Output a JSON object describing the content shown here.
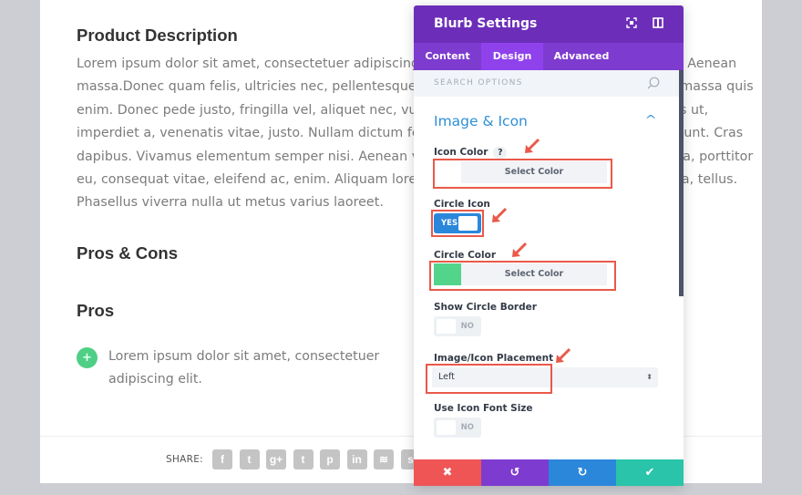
{
  "page": {
    "heading_description": "Product Description",
    "body_lines": [
      "Lorem ipsum dolor sit amet, consectetuer adipiscing elit. Aenean commodo ligula eget dolor. Aenean",
      "massa.Donec quam felis, ultricies nec, pellentesque eu, pretium quis, sem. Nulla consequat massa quis",
      "enim. Donec pede justo, fringilla vel, aliquet nec, vulputate eget, arcu. In enim justo, rhoncus ut,",
      "imperdiet a, venenatis vitae, justo. Nullam dictum felis eu pede mollis pretium. Integer tincidunt. Cras",
      "dapibus. Vivamus elementum semper nisi. Aenean vulputate eleifend tellus. Aenean leo ligula, porttitor",
      "eu, consequat vitae, eleifend ac, enim. Aliquam lorem ante, dapibus in, viverra quis, feugiat a, tellus.",
      "Phasellus viverra nulla ut metus varius laoreet."
    ],
    "heading_pros_cons": "Pros & Cons",
    "heading_pros": "Pros",
    "pro_items": [
      {
        "icon": "plus-circle-icon",
        "glyph": "+",
        "text": "Lorem ipsum dolor sit amet, consectetuer adipiscing elit."
      }
    ],
    "share": {
      "label": "SHARE:",
      "icons": [
        {
          "name": "facebook-icon",
          "glyph": "f"
        },
        {
          "name": "twitter-icon",
          "glyph": "t"
        },
        {
          "name": "google-plus-icon",
          "glyph": "g+"
        },
        {
          "name": "tumblr-icon",
          "glyph": "t"
        },
        {
          "name": "pinterest-icon",
          "glyph": "p"
        },
        {
          "name": "linkedin-icon",
          "glyph": "in"
        },
        {
          "name": "buffer-icon",
          "glyph": "≋"
        },
        {
          "name": "stumbleupon-icon",
          "glyph": "s"
        }
      ]
    }
  },
  "panel": {
    "title": "Blurb Settings",
    "header_icons": [
      "fullscreen-icon",
      "sidebar-toggle-icon"
    ],
    "tabs": [
      {
        "label": "Content",
        "active": false
      },
      {
        "label": "Design",
        "active": true
      },
      {
        "label": "Advanced",
        "active": false
      }
    ],
    "search_placeholder": "SEARCH OPTIONS",
    "section_title": "Image & Icon",
    "fields": {
      "icon_color": {
        "label": "Icon Color",
        "help": "?",
        "button": "Select Color",
        "value": ""
      },
      "circle_icon": {
        "label": "Circle Icon",
        "value": "YES"
      },
      "circle_color": {
        "label": "Circle Color",
        "button": "Select Color",
        "value": "#52d48b"
      },
      "show_circle_border": {
        "label": "Show Circle Border",
        "value": "NO"
      },
      "placement": {
        "label": "Image/Icon Placement",
        "value": "Left"
      },
      "use_icon_font_size": {
        "label": "Use Icon Font Size",
        "value": "NO"
      }
    },
    "footer": [
      {
        "name": "discard-button",
        "glyph": "✖",
        "color": "#ef5555"
      },
      {
        "name": "undo-button",
        "glyph": "↺",
        "color": "#7e3bd0"
      },
      {
        "name": "redo-button",
        "glyph": "↻",
        "color": "#2b87da"
      },
      {
        "name": "save-button",
        "glyph": "✔",
        "color": "#29c4a9"
      }
    ]
  },
  "colors": {
    "accent_purple": "#6c2eb9",
    "tab_purple": "#7e3bd0",
    "active_tab": "#8f42ec",
    "highlight_red": "#e9594a",
    "section_blue": "#2e8fd6",
    "toggle_blue": "#2b87da",
    "pro_green": "#4fcf85"
  }
}
